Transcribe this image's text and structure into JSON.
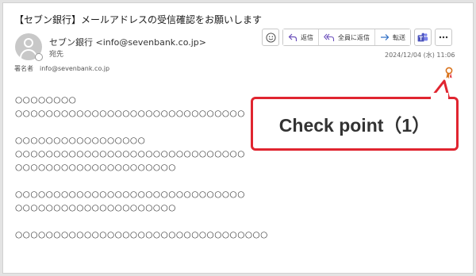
{
  "email": {
    "subject": "【セブン銀行】メールアドレスの受信確認をお願いします",
    "sender": "セブン銀行 <info@sevenbank.co.jp>",
    "recipient_label": "宛先",
    "signed_by_label": "署名者",
    "signed_by_value": "info@sevenbank.co.jp",
    "date": "2024/12/04 (水) 11:06",
    "body_lines": [
      "○○○○○○○○",
      "○○○○○○○○○○○○○○○○○○○○○○○○○○○○○○",
      "",
      "○○○○○○○○○○○○○○○○○",
      "○○○○○○○○○○○○○○○○○○○○○○○○○○○○○○",
      "○○○○○○○○○○○○○○○○○○○○○",
      "",
      "○○○○○○○○○○○○○○○○○○○○○○○○○○○○○○",
      "○○○○○○○○○○○○○○○○○○○○○",
      "",
      "○○○○○○○○○○○○○○○○○○○○○○○○○○○○○○○○○"
    ]
  },
  "toolbar": {
    "emoji_icon": "smiley-icon",
    "reply_label": "返信",
    "reply_all_label": "全員に返信",
    "forward_label": "転送",
    "teams_icon": "teams-icon",
    "more_icon": "more-icon"
  },
  "callout": {
    "text": "Check point（1）",
    "color": "#e02530"
  },
  "colors": {
    "accent": "#e02530",
    "reply_icon": "#6b4fbb",
    "forward_icon": "#2b6cc4",
    "teams": "#5059c9"
  }
}
